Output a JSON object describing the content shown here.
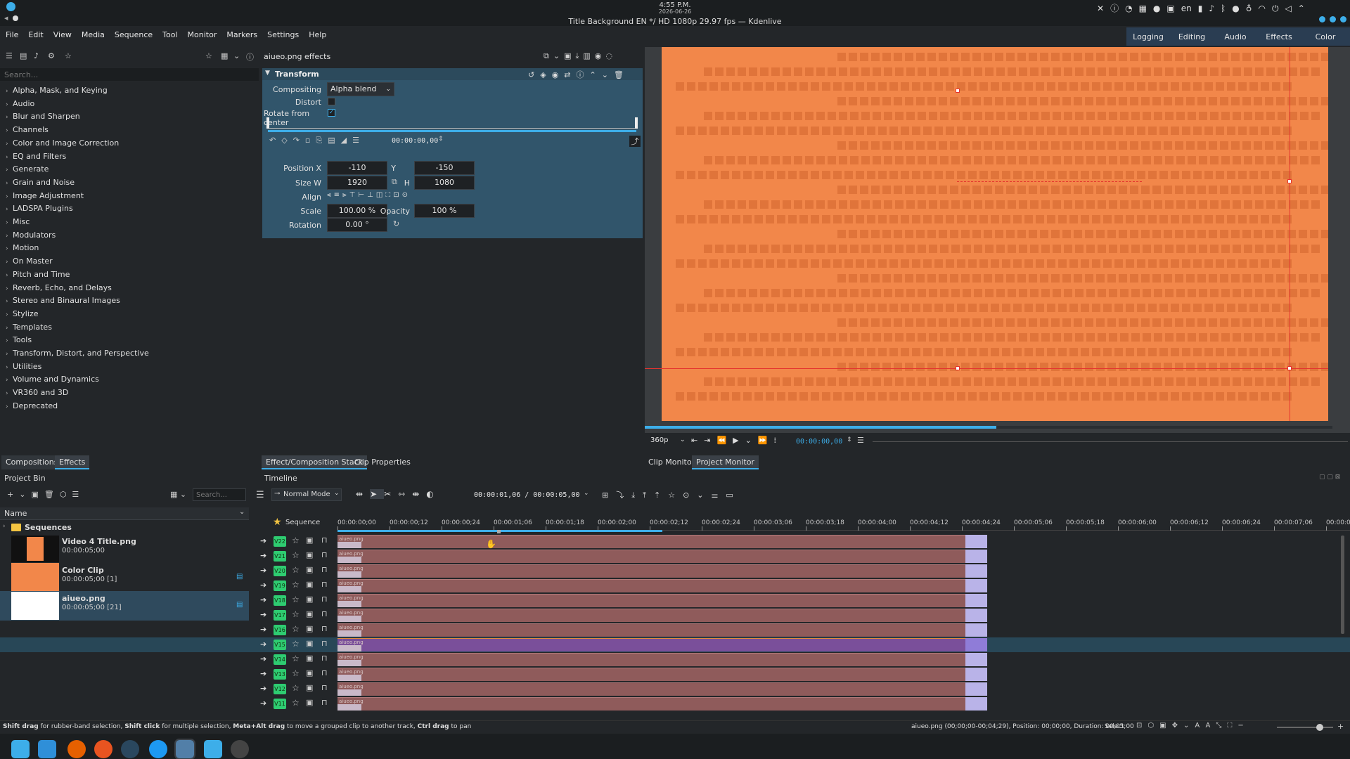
{
  "system": {
    "time": "4:55 P.M.",
    "date": "2026-06-26",
    "window_title": "Title Background EN */ HD 1080p 29.97 fps — Kdenlive",
    "lang": "en"
  },
  "menu": [
    "File",
    "Edit",
    "View",
    "Media",
    "Sequence",
    "Tool",
    "Monitor",
    "Markers",
    "Settings",
    "Help"
  ],
  "workspaces": [
    "Logging",
    "Editing",
    "Audio",
    "Effects",
    "Color"
  ],
  "effects_panel": {
    "search_placeholder": "Search...",
    "categories": [
      "Alpha, Mask, and Keying",
      "Audio",
      "Blur and Sharpen",
      "Channels",
      "Color and Image Correction",
      "EQ and Filters",
      "Generate",
      "Grain and Noise",
      "Image Adjustment",
      "LADSPA Plugins",
      "Misc",
      "Modulators",
      "Motion",
      "On Master",
      "Pitch and Time",
      "Reverb, Echo, and Delays",
      "Stereo and Binaural Images",
      "Stylize",
      "Templates",
      "Tools",
      "Transform, Distort, and Perspective",
      "Utilities",
      "Volume and Dynamics",
      "VR360 and 3D",
      "Deprecated"
    ],
    "tabs": [
      "Compositions",
      "Effects"
    ]
  },
  "effect_stack": {
    "title": "aiueo.png effects",
    "effect_name": "Transform",
    "compositing_label": "Compositing",
    "compositing_value": "Alpha blend",
    "distort_label": "Distort",
    "rotate_label": "Rotate from center",
    "keyframe_time": "00:00:00,00",
    "position_label": "Position X",
    "position_x": "-110",
    "y_label": "Y",
    "position_y": "-150",
    "size_label": "Size W",
    "size_w": "1920",
    "h_label": "H",
    "size_h": "1080",
    "align_label": "Align",
    "scale_label": "Scale",
    "scale": "100.00 %",
    "opacity_label": "Opacity",
    "opacity": "100 %",
    "rotation_label": "Rotation",
    "rotation": "0.00 °",
    "tabs": [
      "Effect/Composition Stack",
      "Clip Properties"
    ]
  },
  "monitor": {
    "resolution": "360p",
    "timecode": "00:00:00,00",
    "tabs": [
      "Clip Monitor",
      "Project Monitor"
    ],
    "frame_color": "#f2874a"
  },
  "project_bin": {
    "title": "Project Bin",
    "search_placeholder": "Search...",
    "name_header": "Name",
    "folder": "Sequences",
    "items": [
      {
        "name": "Video 4 Title.png",
        "duration": "00:00:05;00"
      },
      {
        "name": "Color Clip",
        "duration": "00:00:05;00 [1]"
      },
      {
        "name": "aiueo.png",
        "duration": "00:00:05;00 [21]"
      }
    ]
  },
  "timeline": {
    "title": "Timeline",
    "mode": "Normal Mode",
    "position": "00:00:01,06 / 00:00:05,00",
    "sequence_label": "Sequence",
    "ruler": [
      "00:00:00;00",
      "00:00:00;12",
      "00:00:00;24",
      "00:00:01;06",
      "00:00:01;18",
      "00:00:02;00",
      "00:00:02;12",
      "00:00:02;24",
      "00:00:03;06",
      "00:00:03;18",
      "00:00:04;00",
      "00:00:04;12",
      "00:00:04;24",
      "00:00:05;06",
      "00:00:05;18",
      "00:00:06;00",
      "00:00:06;12",
      "00:00:06;24",
      "00:00:07;06",
      "00:00:0"
    ],
    "tracks": [
      "V22",
      "V21",
      "V20",
      "V19",
      "V18",
      "V17",
      "V16",
      "V15",
      "V14",
      "V13",
      "V12",
      "V11"
    ],
    "clip_label": "aiueo.png"
  },
  "status": {
    "hint_parts": [
      "Shift drag",
      " for rubber-band selection, ",
      "Shift click",
      " for multiple selection, ",
      "Meta+Alt drag",
      " to move a grouped clip to another track, ",
      "Ctrl drag",
      " to pan"
    ],
    "clip_info": "aiueo.png (00;00;00-00;04;29), Position: 00;00;00, Duration: 00;05;00",
    "tool": "Select"
  }
}
